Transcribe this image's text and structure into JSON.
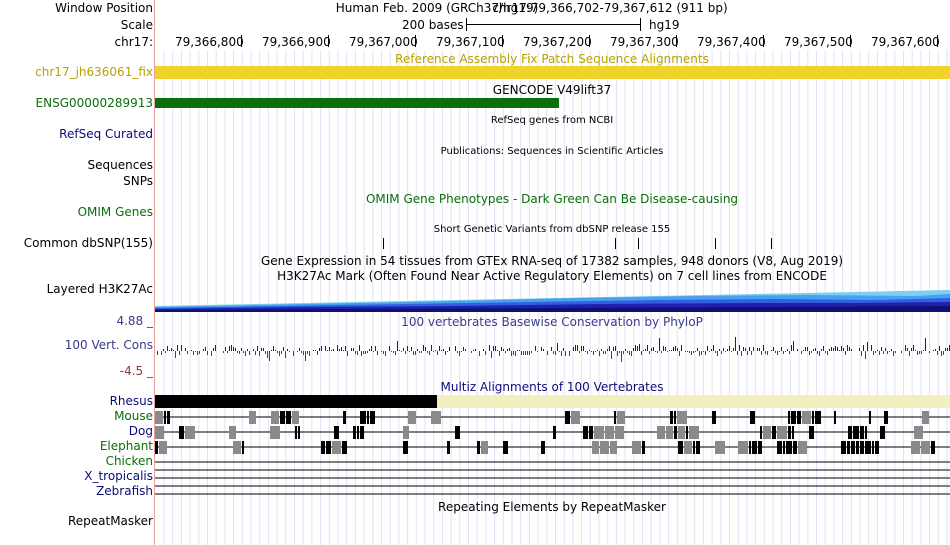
{
  "header": {
    "window_position_label": "Window Position",
    "scale_label": "Scale",
    "chrom_label": "chr17:",
    "assembly": "Human Feb. 2009 (GRCh37/hg19)",
    "position": "chr17:79,366,702-79,367,612 (911 bp)",
    "scale_text": "200 bases",
    "db": "hg19",
    "ticks": [
      "79,366,800",
      "79,366,900",
      "79,367,000",
      "79,367,100",
      "79,367,200",
      "79,367,300",
      "79,367,400",
      "79,367,500",
      "79,367,600"
    ]
  },
  "tracks": {
    "fix_patch": {
      "label": "chr17_jh636061_fix",
      "title": "Reference Assembly Fix Patch Sequence Alignments",
      "color": "#b8a200",
      "bar_color": "#f0d32a"
    },
    "gencode": {
      "label": "ENSG00000289913",
      "title": "GENCODE V49lift37",
      "color": "#0a6e0a"
    },
    "refseq": {
      "label": "RefSeq Curated",
      "title": "RefSeq genes from NCBI",
      "color": "#0c0c78"
    },
    "pubs": {
      "label1": "Sequences",
      "label2": "SNPs",
      "title": "Publications: Sequences in Scientific Articles"
    },
    "omim": {
      "label": "OMIM Genes",
      "title": "OMIM Gene Phenotypes - Dark Green Can Be Disease-causing",
      "color": "#0a6e0a"
    },
    "dbsnp": {
      "label": "Common dbSNP(155)",
      "title": "Short Genetic Variants from dbSNP release 155"
    },
    "gtex": {
      "title": "Gene Expression in 54 tissues from GTEx RNA-seq of 17382 samples, 948 donors (V8, Aug 2019)"
    },
    "h3k27ac": {
      "label": "Layered H3K27Ac",
      "title": "H3K27Ac Mark (Often Found Near Active Regulatory Elements) on 7 cell lines from ENCODE"
    },
    "cons": {
      "label": "100 Vert. Cons",
      "max": "4.88 _",
      "min": "-4.5 _",
      "title": "100 vertebrates Basewise Conservation by PhyloP",
      "color": "#3a3a8c"
    },
    "multiz": {
      "title": "Multiz Alignments of 100 Vertebrates",
      "color": "#0c0c78",
      "species": [
        "Rhesus",
        "Mouse",
        "Dog",
        "Elephant",
        "Chicken",
        "X_tropicalis",
        "Zebrafish"
      ]
    },
    "rmsk": {
      "label": "RepeatMasker",
      "title": "Repeating Elements by RepeatMasker"
    }
  }
}
